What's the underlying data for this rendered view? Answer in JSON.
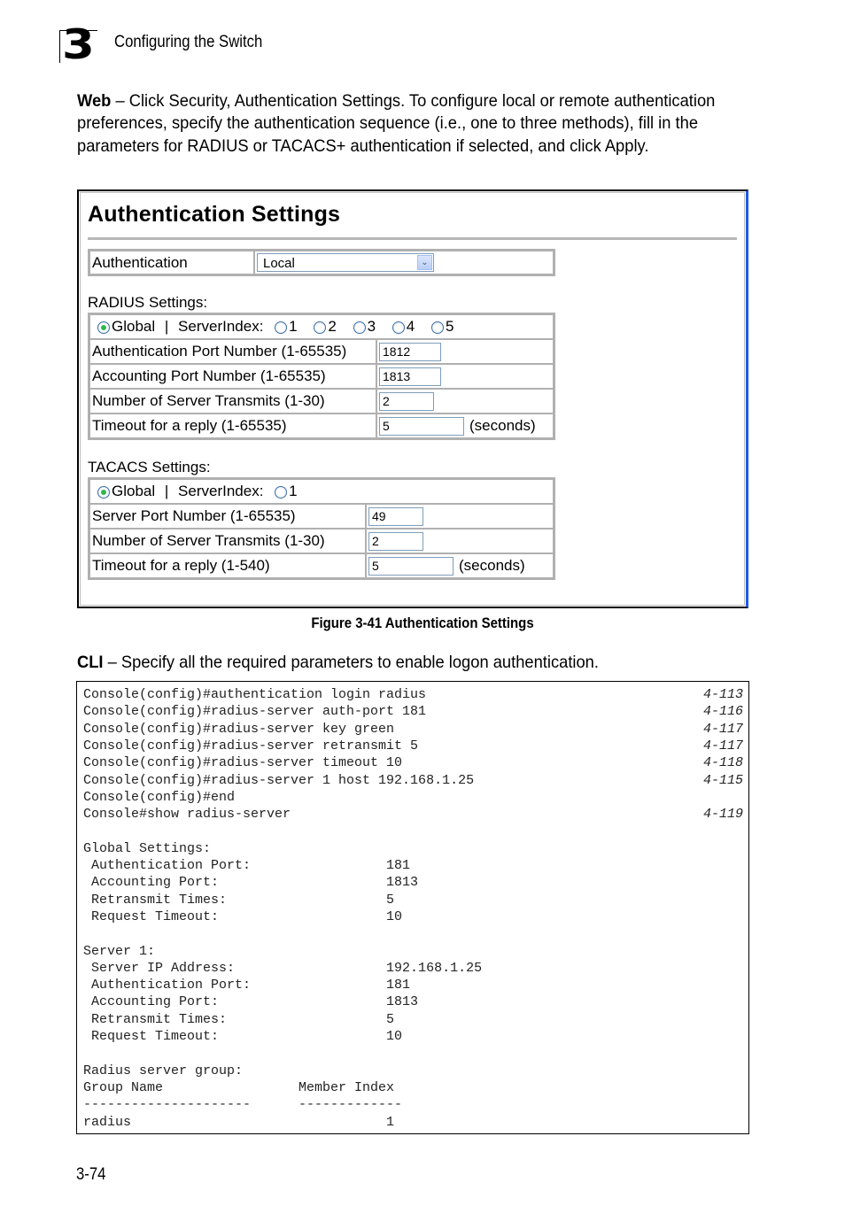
{
  "header": {
    "chapter_number": "3",
    "chapter_title": "Configuring the Switch"
  },
  "web_paragraph": {
    "lead": "Web",
    "text": " – Click Security, Authentication Settings. To configure local or remote authentication preferences, specify the authentication sequence (i.e., one to three methods), fill in the parameters for RADIUS or TACACS+ authentication if selected, and click Apply."
  },
  "figure": {
    "title": "Authentication Settings",
    "authentication": {
      "label": "Authentication",
      "selected": "Local"
    },
    "radius": {
      "section_label": "RADIUS Settings:",
      "scope_global_label": "Global",
      "separator": "|",
      "server_index_label": "ServerIndex:",
      "server_indexes": [
        "1",
        "2",
        "3",
        "4",
        "5"
      ],
      "selected_scope": "Global",
      "fields": [
        {
          "label": "Authentication Port Number (1-65535)",
          "value": "1812",
          "unit": ""
        },
        {
          "label": "Accounting Port Number (1-65535)",
          "value": "1813",
          "unit": ""
        },
        {
          "label": "Number of Server Transmits (1-30)",
          "value": "2",
          "unit": ""
        },
        {
          "label": "Timeout for a reply (1-65535)",
          "value": "5",
          "unit": "(seconds)"
        }
      ]
    },
    "tacacs": {
      "section_label": "TACACS Settings:",
      "scope_global_label": "Global",
      "separator": "|",
      "server_index_label": "ServerIndex:",
      "server_indexes": [
        "1"
      ],
      "selected_scope": "Global",
      "fields": [
        {
          "label": "Server Port Number (1-65535)",
          "value": "49",
          "unit": ""
        },
        {
          "label": "Number of Server Transmits (1-30)",
          "value": "2",
          "unit": ""
        },
        {
          "label": "Timeout for a reply (1-540)",
          "value": "5",
          "unit": "(seconds)"
        }
      ]
    },
    "caption": "Figure 3-41  Authentication Settings"
  },
  "cli_paragraph": {
    "lead": "CLI",
    "text": " – Specify all the required parameters to enable logon authentication."
  },
  "cli": {
    "lines": [
      {
        "text": "Console(config)#authentication login radius",
        "ref": "4-113"
      },
      {
        "text": "Console(config)#radius-server auth-port 181",
        "ref": "4-116"
      },
      {
        "text": "Console(config)#radius-server key green",
        "ref": "4-117"
      },
      {
        "text": "Console(config)#radius-server retransmit 5",
        "ref": "4-117"
      },
      {
        "text": "Console(config)#radius-server timeout 10",
        "ref": "4-118"
      },
      {
        "text": "Console(config)#radius-server 1 host 192.168.1.25",
        "ref": "4-115"
      },
      {
        "text": "Console(config)#end",
        "ref": ""
      },
      {
        "text": "Console#show radius-server",
        "ref": "4-119"
      },
      {
        "text": "",
        "ref": ""
      },
      {
        "text": "Global Settings:",
        "ref": ""
      },
      {
        "text": " Authentication Port:                 181",
        "ref": ""
      },
      {
        "text": " Accounting Port:                     1813",
        "ref": ""
      },
      {
        "text": " Retransmit Times:                    5",
        "ref": ""
      },
      {
        "text": " Request Timeout:                     10",
        "ref": ""
      },
      {
        "text": "",
        "ref": ""
      },
      {
        "text": "Server 1:",
        "ref": ""
      },
      {
        "text": " Server IP Address:                   192.168.1.25",
        "ref": ""
      },
      {
        "text": " Authentication Port:                 181",
        "ref": ""
      },
      {
        "text": " Accounting Port:                     1813",
        "ref": ""
      },
      {
        "text": " Retransmit Times:                    5",
        "ref": ""
      },
      {
        "text": " Request Timeout:                     10",
        "ref": ""
      },
      {
        "text": "",
        "ref": ""
      },
      {
        "text": "Radius server group:",
        "ref": ""
      },
      {
        "text": "Group Name                 Member Index",
        "ref": ""
      },
      {
        "text": "---------------------      -------------",
        "ref": ""
      },
      {
        "text": "radius                                1",
        "ref": ""
      }
    ]
  },
  "footer": {
    "page_number": "3-74"
  },
  "colors": {
    "frame_accent": "#1e5ae6",
    "radio_selected": "#2db84a",
    "input_border": "#7f9db9",
    "table_border": "#b0b0b0"
  }
}
